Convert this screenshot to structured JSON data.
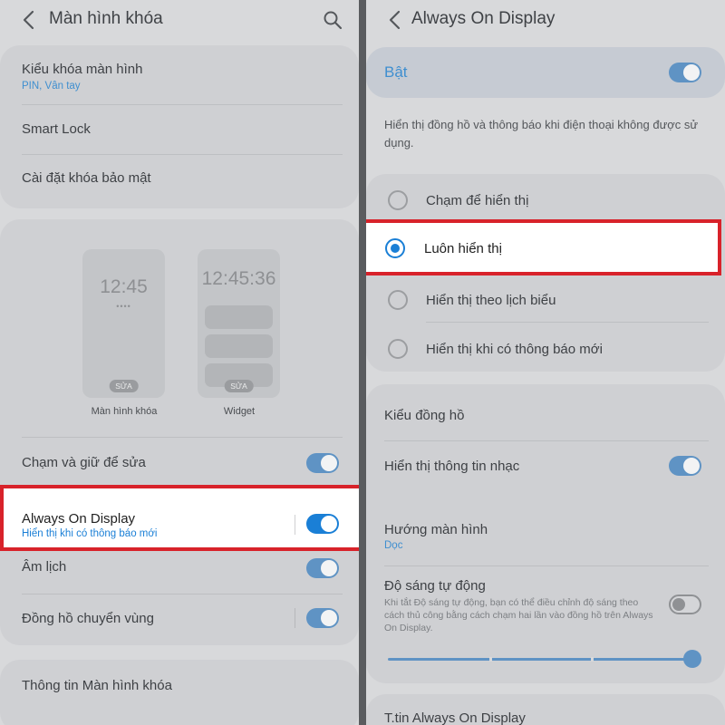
{
  "left": {
    "title": "Màn hình khóa",
    "lock_type": {
      "title": "Kiểu khóa màn hình",
      "sub": "PIN, Vân tay"
    },
    "smart_lock": "Smart Lock",
    "secure_lock": "Cài đặt khóa bảo mật",
    "preview_lock": {
      "time": "12:45",
      "dots": "••••",
      "edit": "SỬA",
      "label": "Màn hình khóa"
    },
    "preview_widget": {
      "time": "12:45:36",
      "edit": "SỬA",
      "label": "Widget"
    },
    "touch_hold": {
      "title": "Chạm và giữ để sửa",
      "on": true
    },
    "aod": {
      "title": "Always On Display",
      "sub": "Hiển thị khi có thông báo mới",
      "on": true
    },
    "lunar": {
      "title": "Âm lịch",
      "on": true
    },
    "roaming_clock": {
      "title": "Đồng hồ chuyển vùng",
      "on": true
    },
    "info": "Thông tin Màn hình khóa"
  },
  "right": {
    "title": "Always On Display",
    "enabled": {
      "label": "Bật",
      "on": true
    },
    "description": "Hiển thị đồng hồ và thông báo khi điện thoại không được sử dụng.",
    "options": [
      {
        "label": "Chạm để hiển thị",
        "selected": false
      },
      {
        "label": "Luôn hiển thị",
        "selected": true
      },
      {
        "label": "Hiển thị theo lịch biểu",
        "selected": false
      },
      {
        "label": "Hiển thị khi có thông báo mới",
        "selected": false
      }
    ],
    "clock_style": "Kiểu đồng hồ",
    "music_info": {
      "title": "Hiển thị thông tin nhạc",
      "on": true
    },
    "orientation": {
      "title": "Hướng màn hình",
      "sub": "Dọc"
    },
    "auto_brightness": {
      "title": "Độ sáng tự động",
      "desc": "Khi tắt Độ sáng tự động, bạn có thể điều chỉnh độ sáng theo cách thủ công bằng cách chạm hai lần vào đồng hồ trên Always On Display.",
      "on": false,
      "brightness_level": 1.0
    },
    "about": "T.tin Always On Display"
  },
  "colors": {
    "accent": "#1a7fd6",
    "highlight": "#d8222a",
    "dim_background": "#d8d9db"
  }
}
